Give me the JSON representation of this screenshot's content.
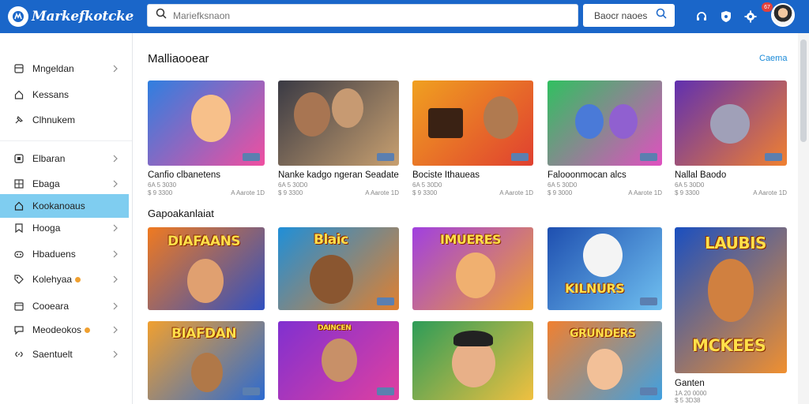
{
  "app": {
    "name": "Markefkotcke"
  },
  "header": {
    "search_placeholder": "Mariefksnaon",
    "search2_label": "Baocr naoes",
    "badge_count": "67"
  },
  "sidebar": {
    "items": [
      {
        "label": "Mngeldan",
        "icon": "box-icon",
        "chevron": true
      },
      {
        "label": "Kessans",
        "icon": "home-icon",
        "chevron": false
      },
      {
        "label": "Clhnukem",
        "icon": "pin-icon",
        "chevron": false
      },
      {
        "label": "Elbaran",
        "icon": "square-icon",
        "chevron": true
      },
      {
        "label": "Ebaga",
        "icon": "grid-icon",
        "chevron": true
      },
      {
        "label": "Kookanoaus",
        "icon": "home-icon",
        "chevron": false,
        "active": true
      },
      {
        "label": "Hooga",
        "icon": "bookmark-icon",
        "chevron": true
      },
      {
        "label": "Hbaduens",
        "icon": "gamepad-icon",
        "chevron": true
      },
      {
        "label": "Kolehyaa",
        "icon": "tag-icon",
        "chevron": true,
        "dot": true
      },
      {
        "label": "Cooeara",
        "icon": "calendar-icon",
        "chevron": true
      },
      {
        "label": "Meodeokos",
        "icon": "chat-icon",
        "chevron": true,
        "dot": true
      },
      {
        "label": "Saentuelt",
        "icon": "link-icon",
        "chevron": true
      }
    ]
  },
  "main": {
    "section1_title": "Malliaooear",
    "see_all": "Caema",
    "section2_title": "Gapoakanlaiat",
    "row1": [
      {
        "title": "Canfio clbanetens",
        "meta1": "6A 5 3030",
        "meta2": "$ 9 3300",
        "meta3": "A Aarote 1D",
        "bg1": "#2f7fe0",
        "bg2": "#f04fa0"
      },
      {
        "title": "Nanke kadgo ngeran Seadate",
        "meta1": "6A 5 30D0",
        "meta2": "$ 9 3300",
        "meta3": "A Aarote 1D",
        "bg1": "#3a3a44",
        "bg2": "#c8a070"
      },
      {
        "title": "Bociste Ithaueas",
        "meta1": "6A 5 30D0",
        "meta2": "$ 9 3300",
        "meta3": "A Aarote 1D",
        "bg1": "#f0a020",
        "bg2": "#e04030"
      },
      {
        "title": "Falooonmocan alcs",
        "meta1": "6A 5 30D0",
        "meta2": "$ 9 3000",
        "meta3": "A Aarote 1D",
        "bg1": "#30c060",
        "bg2": "#e050c0"
      },
      {
        "title": "Nallal     Baodo",
        "meta1": "6A 5 30D0",
        "meta2": "$ 9 3300",
        "meta3": "A Aarote 1D",
        "bg1": "#6030b0",
        "bg2": "#f08030"
      }
    ],
    "row2": [
      {
        "banner": "DIAFAANS",
        "bg1": "#f07a20",
        "bg2": "#3050c0"
      },
      {
        "banner": "Blaic",
        "bg1": "#1f8fd8",
        "bg2": "#e0802f"
      },
      {
        "banner": "IMUERES",
        "bg1": "#a040e0",
        "bg2": "#f0a030"
      },
      {
        "banner": "KILNURS",
        "bg1": "#1e4fb0",
        "bg2": "#70c0f0"
      }
    ],
    "row3": [
      {
        "banner": "BIAFDAN",
        "bg1": "#f0a030",
        "bg2": "#2c6ad0"
      },
      {
        "banner": "DAINCEN",
        "bg1": "#8030d0",
        "bg2": "#e040a0"
      },
      {
        "banner": "",
        "bg1": "#2d9c58",
        "bg2": "#f0c040"
      },
      {
        "banner": "GRUNDERS",
        "bg1": "#f08030",
        "bg2": "#40a0e0"
      }
    ],
    "tall_card": {
      "banner_top": "LAUBIS",
      "banner_bottom": "MCKEES",
      "title": "Ganten",
      "meta1": "1A 20 0000",
      "meta2": "$ 5 3D38",
      "bg1": "#1a4fc0",
      "bg2": "#f09030"
    }
  }
}
